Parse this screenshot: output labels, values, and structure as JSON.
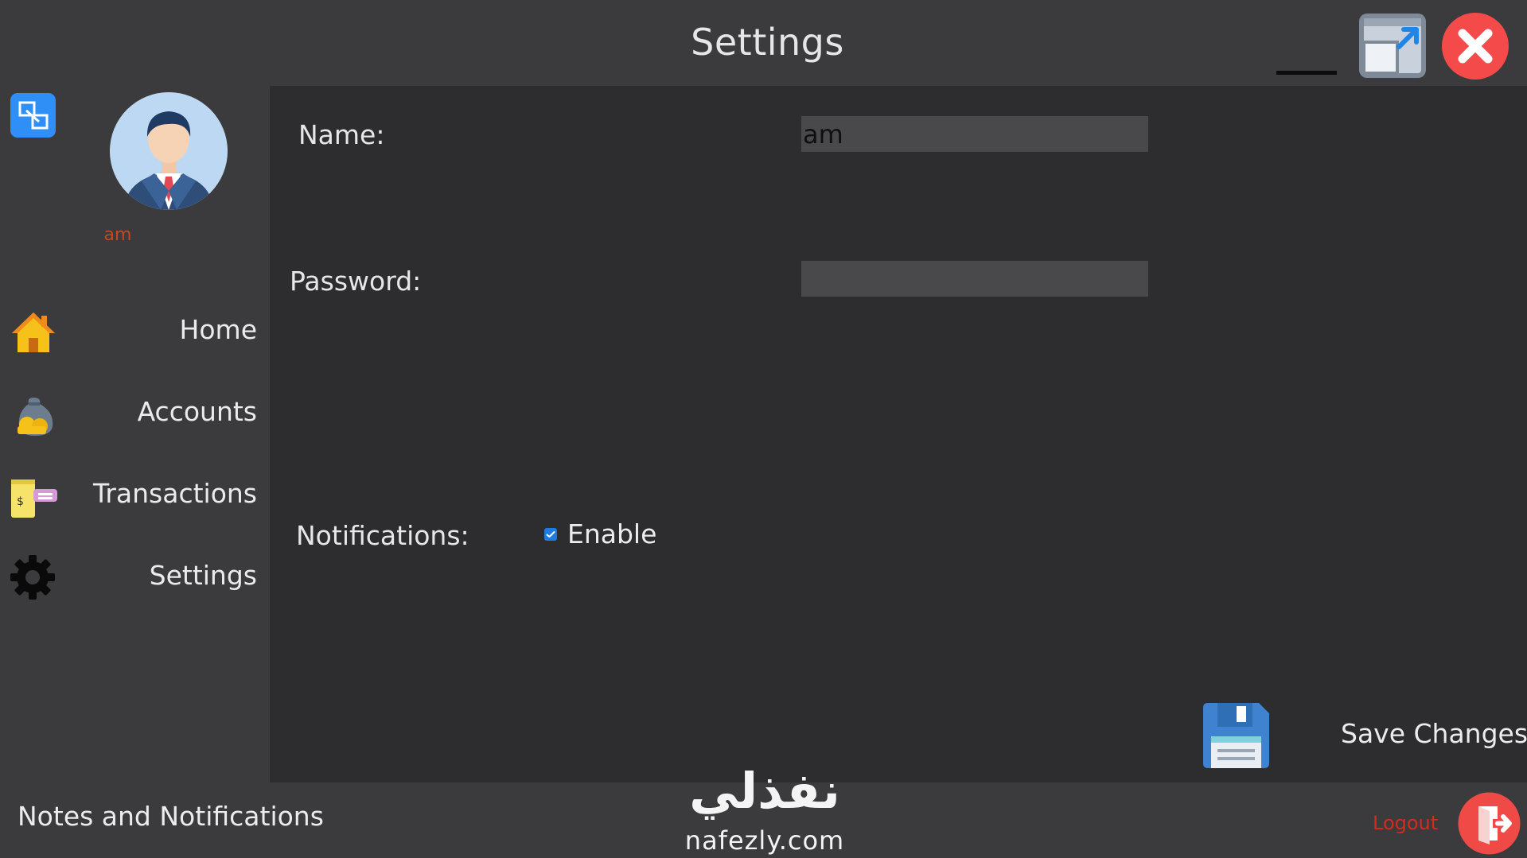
{
  "window": {
    "title": "Settings",
    "controls": [
      "minimize",
      "restore",
      "close"
    ]
  },
  "user": {
    "name": "am"
  },
  "sidebar": {
    "items": [
      {
        "label": "Home",
        "icon": "home-icon",
        "active": false
      },
      {
        "label": "Accounts",
        "icon": "money-bag-icon",
        "active": false
      },
      {
        "label": "Transactions",
        "icon": "transactions-icon",
        "active": false
      },
      {
        "label": "Settings",
        "icon": "gear-icon",
        "active": true
      }
    ]
  },
  "form": {
    "name_label": "Name:",
    "name_value": "am",
    "password_label": "Password:",
    "password_value": "",
    "notifications_label": "Notifications:",
    "notifications_option": "Enable",
    "notifications_checked": true,
    "save_label": "Save Changes"
  },
  "footer": {
    "notes_label": "Notes and Notifications",
    "logout_label": "Logout"
  },
  "watermark": {
    "arabic": "نفذلي",
    "latin": "nafezly.com"
  },
  "colors": {
    "frame": "#3b3a3c",
    "panel": "#2d2c2f",
    "input": "#49484b",
    "accent_blue": "#2f8ff6",
    "close_red": "#f44a4a",
    "user_name": "#c8471f",
    "logout_red": "#d42b1f"
  }
}
